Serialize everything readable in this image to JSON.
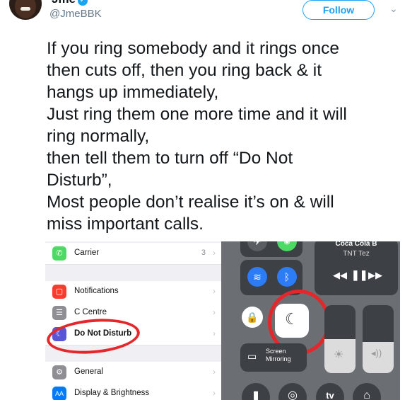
{
  "header": {
    "name": "Jme",
    "handle": "@JmeBBK",
    "follow_label": "Follow",
    "verified_glyph": "✓",
    "menu_glyph": "⌄"
  },
  "tweet": {
    "lines": [
      "If you ring somebody and it rings once",
      "then cuts off, then you ring back & it",
      "hangs up immediately,",
      "Just ring them one more time and it will",
      "ring normally,",
      "then tell them to turn off “Do Not",
      "Disturb”,",
      "Most people don’t realise it’s on & will",
      "miss important calls."
    ]
  },
  "settings": {
    "rows": [
      {
        "label": "Carrier",
        "value": "3",
        "icon": "phone-icon",
        "color": "#4cd964"
      },
      {
        "label": "Notifications",
        "value": "",
        "icon": "notifications-icon",
        "color": "#ff3b30"
      },
      {
        "label": "C     Centre",
        "value": "",
        "icon": "control-centre-icon",
        "color": "#8e8e93"
      },
      {
        "label": "Do Not Disturb",
        "value": "",
        "icon": "moon-icon",
        "color": "#5856d6"
      },
      {
        "label": "General",
        "value": "",
        "icon": "gear-icon",
        "color": "#8e8e93"
      },
      {
        "label": "Display & Brightness",
        "value": "",
        "icon": "display-icon",
        "color": "#007aff"
      }
    ],
    "display_icon_text": "AA",
    "chevron": "›"
  },
  "control_centre": {
    "carrier_name": "Coca Cola B",
    "network": "TNT Tez",
    "screen_mirroring": "Screen Mirroring",
    "tv_label": "tv"
  },
  "colors": {
    "accent": "#1da1f2",
    "annotation": "#e5262a",
    "wifi_active": "#2b7cf6"
  }
}
